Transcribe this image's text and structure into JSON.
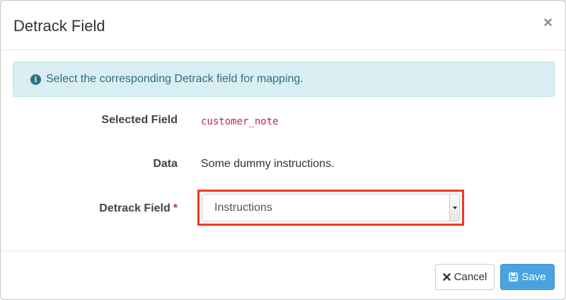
{
  "modal": {
    "title": "Detrack Field",
    "close_symbol": "×"
  },
  "alert": {
    "icon": "info-circle-icon",
    "text": "Select the corresponding Detrack field for mapping.",
    "color": "#d9eef3"
  },
  "form": {
    "selected_field": {
      "label": "Selected Field",
      "value": "customer_note"
    },
    "data": {
      "label": "Data",
      "value": "Some dummy instructions."
    },
    "detrack_field": {
      "label": "Detrack Field",
      "required_marker": "*",
      "selected_value": "Instructions"
    }
  },
  "footer": {
    "cancel_label": "Cancel",
    "cancel_icon": "times-icon",
    "save_label": "Save",
    "save_icon": "floppy-disk-icon",
    "save_color": "#4aa3df"
  },
  "highlight_color": "#ea3a24"
}
